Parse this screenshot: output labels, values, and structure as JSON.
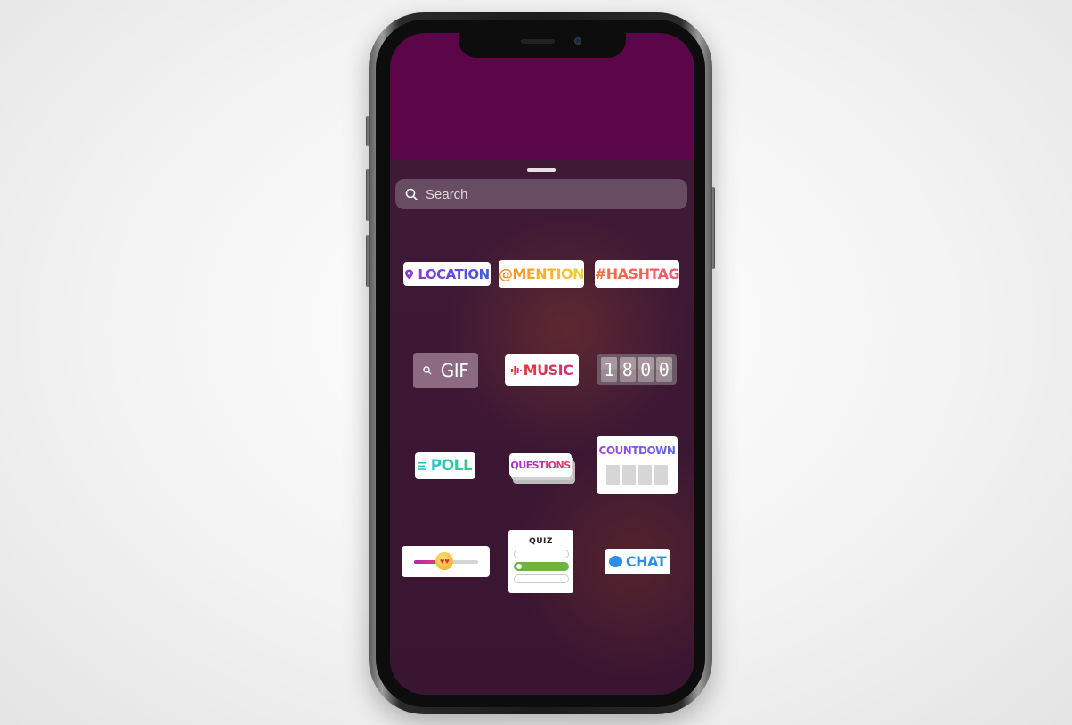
{
  "search": {
    "placeholder": "Search"
  },
  "stickers": {
    "location": "LOCATION",
    "mention": "@MENTION",
    "hashtag": "#HASHTAG",
    "gif": "GIF",
    "music": "MUSIC",
    "time_digits": [
      "1",
      "8",
      "0",
      "0"
    ],
    "poll": "POLL",
    "questions": "QUESTIONS",
    "countdown": "COUNTDOWN",
    "slider_level": 0.45,
    "quiz": "QUIZ",
    "chat": "CHAT"
  },
  "colors": {
    "screen_top": "#5c064a",
    "sheet_background": "#3e1a36",
    "poll_accent": "#2cc1c9",
    "chat_accent": "#2b8fe6",
    "quiz_correct": "#6db33f"
  },
  "icons": [
    "search-icon",
    "location-pin-icon",
    "magnifier-icon",
    "music-bars-icon",
    "poll-lines-icon",
    "heart-eyes-emoji-icon",
    "chat-bubble-icon"
  ]
}
